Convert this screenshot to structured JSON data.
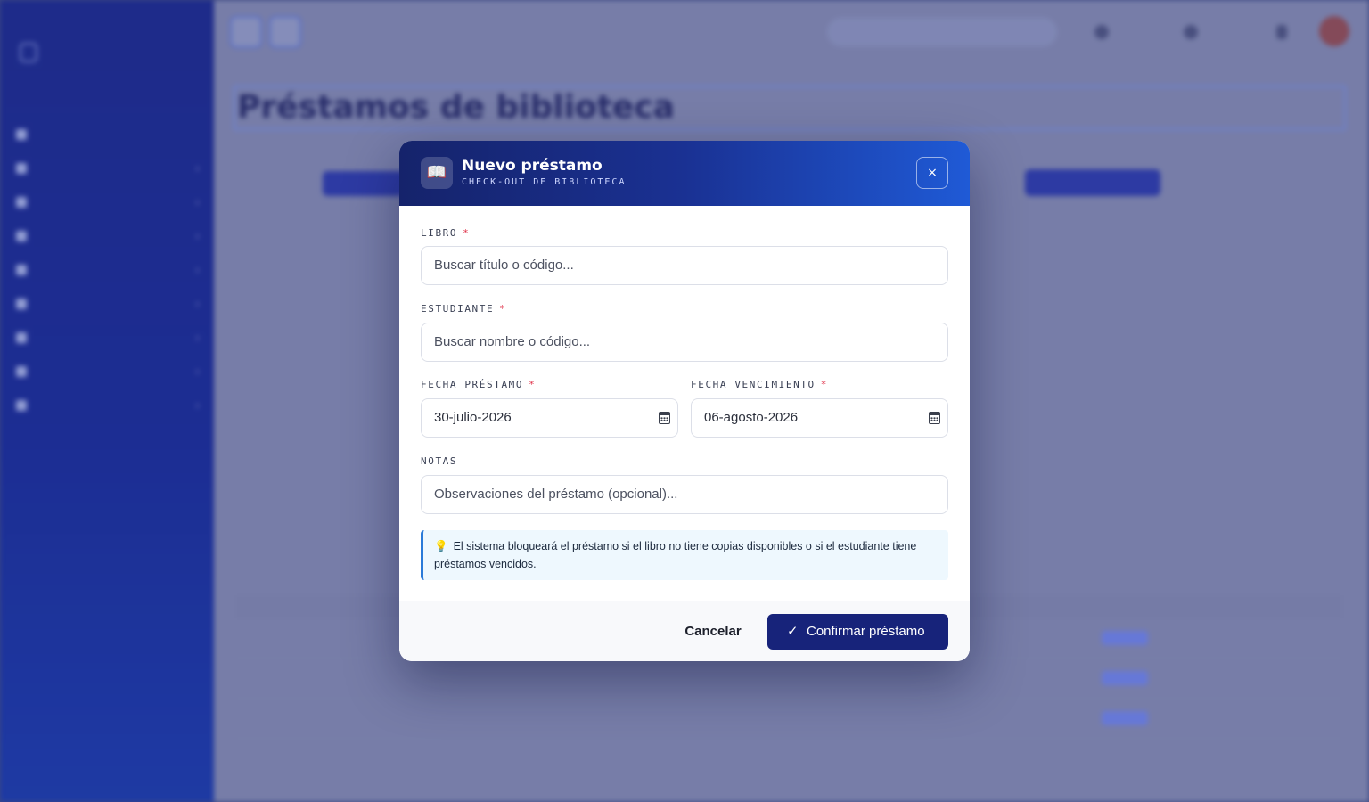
{
  "modal": {
    "icon": "book-icon",
    "title": "Nuevo préstamo",
    "subtitle": "CHECK-OUT DE BIBLIOTECA",
    "close_label": "×",
    "fields": {
      "libro": {
        "label": "LIBRO",
        "required_mark": "*",
        "placeholder": "Buscar título o código..."
      },
      "estudiante": {
        "label": "ESTUDIANTE",
        "required_mark": "*",
        "placeholder": "Buscar nombre o código..."
      },
      "fecha_prestamo": {
        "label": "FECHA PRÉSTAMO",
        "required_mark": "*",
        "value": "30-julio-2026"
      },
      "fecha_vencimiento": {
        "label": "FECHA VENCIMIENTO",
        "required_mark": "*",
        "value": "06-agosto-2026"
      },
      "notas": {
        "label": "NOTAS",
        "placeholder": "Observaciones del préstamo (opcional)..."
      }
    },
    "note": {
      "icon": "lightbulb-icon",
      "text": "El sistema bloqueará el préstamo si el libro no tiene copias disponibles o si el estudiante tiene préstamos vencidos."
    },
    "cancel_label": "Cancelar",
    "confirm_label": "Confirmar préstamo"
  },
  "background": {
    "page_title": "Préstamos de biblioteca"
  },
  "colors": {
    "header_start": "#15236b",
    "header_end": "#1f5ad6",
    "confirm_button": "#17237a",
    "required": "#e0334a",
    "note_border": "#2a7ad8",
    "note_bg": "#eef8fe"
  }
}
